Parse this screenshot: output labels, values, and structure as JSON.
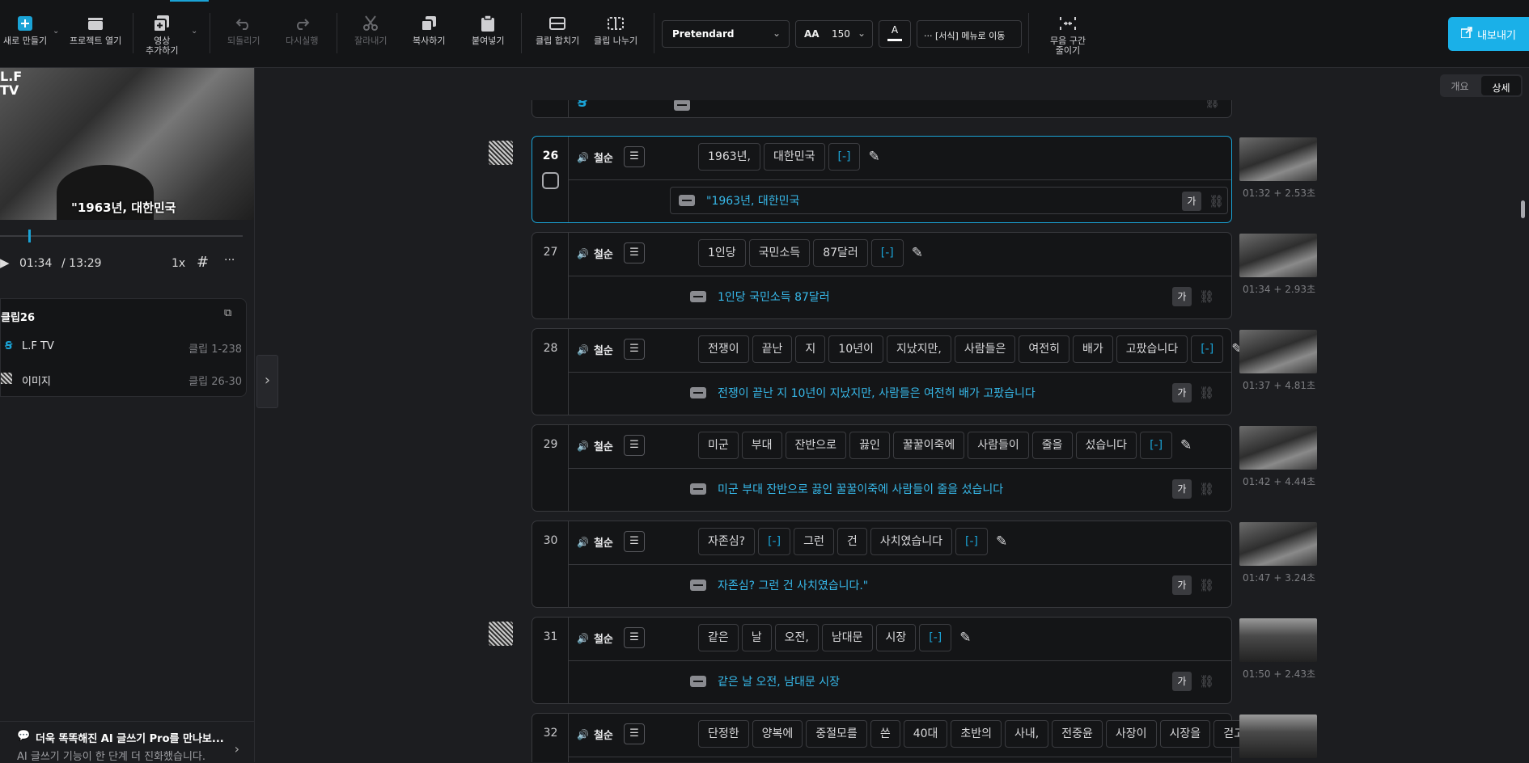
{
  "toolbar": {
    "new_label": "새로 만들기",
    "open_label": "프로젝트 열기",
    "add_video_label": "영상\n추가하기",
    "undo_label": "되돌리기",
    "redo_label": "다시실행",
    "cut_label": "잘라내기",
    "copy_label": "복사하기",
    "paste_label": "붙여넣기",
    "merge_label": "클립 합치기",
    "split_label": "클립 나누기",
    "font": "Pretendard",
    "font_size": "150",
    "font_size_icon": "AA",
    "color_letter": "A",
    "format_menu_label": "[서식] 메뉴로 이동",
    "silence_label": "무음 구간\n줄이기",
    "export_label": "내보내기",
    "accent_color": "#1aa3d6"
  },
  "view_tabs": {
    "overview": "개요",
    "detail": "상세",
    "active": "상세"
  },
  "preview": {
    "logo": "L.F\nTV",
    "caption": "\"1963년, 대한민국",
    "progress": 0.116,
    "time_current": "01:34",
    "time_total": "/ 13:29",
    "speed": "1x"
  },
  "clip_panel": {
    "title": "클립26",
    "rows": [
      {
        "icon": "lftv-logo-icon",
        "name": "L.F TV",
        "range": "클립 1-238"
      },
      {
        "icon": "image-thumb-icon",
        "name": "이미지",
        "range": "클립 26-30"
      }
    ]
  },
  "ai_banner": {
    "title": "더욱 똑똑해진 AI 글쓰기 Pro를 만나보...",
    "subtitle": "AI 글쓰기 기능이 한 단계 더 진화했습니다."
  },
  "clips": [
    {
      "num": "26",
      "speaker": "철순",
      "words": [
        "1963년,",
        "대한민국",
        "[-]"
      ],
      "subtitle": "\"1963년, 대한민국",
      "time": "01:32 + 2.53초",
      "active": true
    },
    {
      "num": "27",
      "speaker": "철순",
      "words": [
        "1인당",
        "국민소득",
        "87달러",
        "[-]"
      ],
      "subtitle": "1인당 국민소득 87달러",
      "time": "01:34 + 2.93초"
    },
    {
      "num": "28",
      "speaker": "철순",
      "words": [
        "전쟁이",
        "끝난",
        "지",
        "10년이",
        "지났지만,",
        "사람들은",
        "여전히",
        "배가",
        "고팠습니다",
        "[-]"
      ],
      "subtitle": "전쟁이 끝난 지 10년이 지났지만, 사람들은 여전히 배가 고팠습니다",
      "time": "01:37 + 4.81초"
    },
    {
      "num": "29",
      "speaker": "철순",
      "words": [
        "미군",
        "부대",
        "잔반으로",
        "끓인",
        "꿀꿀이죽에",
        "사람들이",
        "줄을",
        "섰습니다",
        "[-]"
      ],
      "subtitle": "미군 부대 잔반으로 끓인 꿀꿀이죽에 사람들이 줄을 섰습니다",
      "time": "01:42 + 4.44초"
    },
    {
      "num": "30",
      "speaker": "철순",
      "words": [
        "자존심?",
        "[-]",
        "그런",
        "건",
        "사치였습니다",
        "[-]"
      ],
      "subtitle": "자존심? 그런 건 사치였습니다.\"",
      "time": "01:47 + 3.24초"
    },
    {
      "num": "31",
      "speaker": "철순",
      "words": [
        "같은",
        "날",
        "오전,",
        "남대문",
        "시장",
        "[-]"
      ],
      "subtitle": "같은 날 오전, 남대문 시장",
      "time": "01:50 + 2.43초"
    },
    {
      "num": "32",
      "speaker": "철순",
      "words": [
        "단정한",
        "양복에",
        "중절모를",
        "쓴",
        "40대",
        "초반의",
        "사내,",
        "전중윤",
        "사장이",
        "시장을",
        "걷고"
      ],
      "subtitle": "",
      "time": ""
    }
  ],
  "ga_label": "가"
}
